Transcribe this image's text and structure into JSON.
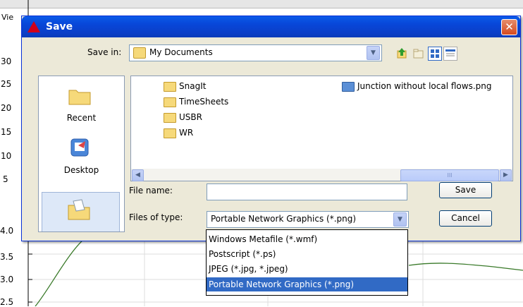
{
  "background_app": {
    "menu_fragment": "Vie",
    "y_tick_fragments": [
      "30",
      "25",
      "20",
      "15",
      "10",
      "5"
    ],
    "y_axis_ticks": [
      "4.0",
      "3.5",
      "3.0",
      "2.5"
    ],
    "line_color": "#3a7a2a"
  },
  "dialog": {
    "title": "Save",
    "close_glyph": "✕",
    "save_in_label": "Save in:",
    "save_in_value": "My Documents",
    "places": [
      {
        "label": "Recent"
      },
      {
        "label": "Desktop"
      },
      {
        "label": ""
      }
    ],
    "files": [
      {
        "name": "SnagIt",
        "kind": "folder"
      },
      {
        "name": "TimeSheets",
        "kind": "folder"
      },
      {
        "name": "USBR",
        "kind": "folder"
      },
      {
        "name": "WR",
        "kind": "folder"
      },
      {
        "name": "Junction without local flows.png",
        "kind": "png"
      }
    ],
    "scroll_thumb_text": "III",
    "file_name_label": "File name:",
    "file_name_value": "",
    "files_of_type_label": "Files of type:",
    "files_of_type_value": "Portable Network Graphics (*.png)",
    "save_button": "Save",
    "cancel_button": "Cancel",
    "type_options": [
      "Windows Metafile (*.wmf)",
      "Postscript (*.ps)",
      "JPEG (*.jpg, *.jpeg)",
      "Portable Network Graphics (*.png)"
    ],
    "selected_type_index": 3
  },
  "colors": {
    "title_bar": "#0a5ae8",
    "selection": "#316ac5",
    "dialog_bg": "#ece9d8"
  }
}
